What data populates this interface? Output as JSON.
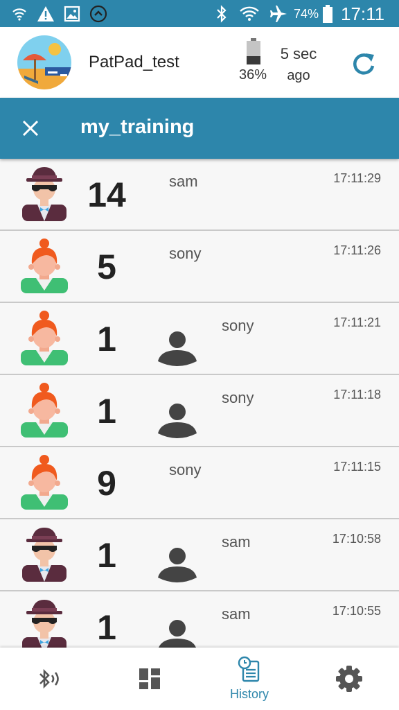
{
  "status_bar": {
    "battery_percent": "74%",
    "clock": "17:11",
    "icons": [
      "wifi-calling-icon",
      "warning-icon",
      "image-icon",
      "upload-icon",
      "bluetooth-icon",
      "wifi-icon",
      "airplane-icon",
      "battery-icon"
    ]
  },
  "header": {
    "device_name": "PatPad_test",
    "battery_level": "36%",
    "battery_fill_fraction": 0.36,
    "sync_time": "5 sec",
    "sync_ago": "ago",
    "icons": [
      "beach-avatar-icon",
      "device-battery-icon",
      "refresh-icon"
    ]
  },
  "title_bar": {
    "title": "my_training",
    "close_icon": "close-icon"
  },
  "history": [
    {
      "avatar": "spy",
      "count": "14",
      "name": "sam",
      "time": "17:11:29",
      "has_person": false
    },
    {
      "avatar": "woman",
      "count": "5",
      "name": "sony",
      "time": "17:11:26",
      "has_person": false
    },
    {
      "avatar": "woman",
      "count": "1",
      "name": "sony",
      "time": "17:11:21",
      "has_person": true
    },
    {
      "avatar": "woman",
      "count": "1",
      "name": "sony",
      "time": "17:11:18",
      "has_person": true
    },
    {
      "avatar": "woman",
      "count": "9",
      "name": "sony",
      "time": "17:11:15",
      "has_person": false
    },
    {
      "avatar": "spy",
      "count": "1",
      "name": "sam",
      "time": "17:10:58",
      "has_person": true
    },
    {
      "avatar": "spy",
      "count": "1",
      "name": "sam",
      "time": "17:10:55",
      "has_person": true
    }
  ],
  "bottom_nav": {
    "items": [
      {
        "icon": "bluetooth-signal-icon",
        "label": ""
      },
      {
        "icon": "dashboard-icon",
        "label": ""
      },
      {
        "icon": "history-icon",
        "label": "History",
        "active": true
      },
      {
        "icon": "settings-icon",
        "label": ""
      }
    ],
    "active_color": "#2d86ab"
  },
  "colors": {
    "primary": "#2d86ab",
    "list_background": "#f7f7f7"
  }
}
